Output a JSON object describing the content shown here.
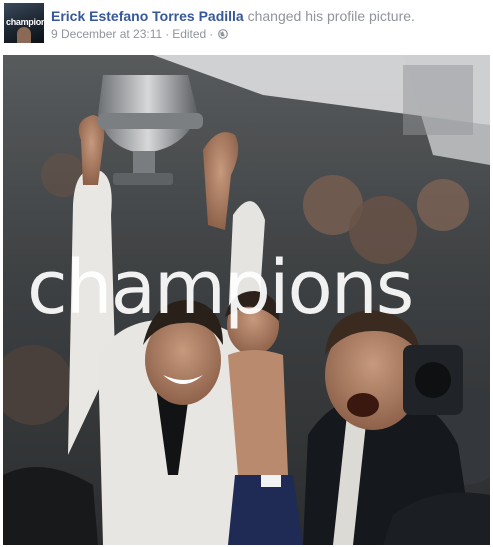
{
  "post": {
    "author": "Erick Estefano Torres Padilla",
    "action": "changed his profile picture.",
    "timestamp": "9 December at 23:11",
    "separator": "·",
    "edited": "Edited",
    "audience_icon": "globe-icon",
    "avatar_text": "champion"
  },
  "photo": {
    "caption": "champions",
    "icon": "trophy"
  },
  "colors": {
    "author_link": "#365899",
    "meta_text": "#90949c",
    "body_text": "#4b4f56"
  }
}
